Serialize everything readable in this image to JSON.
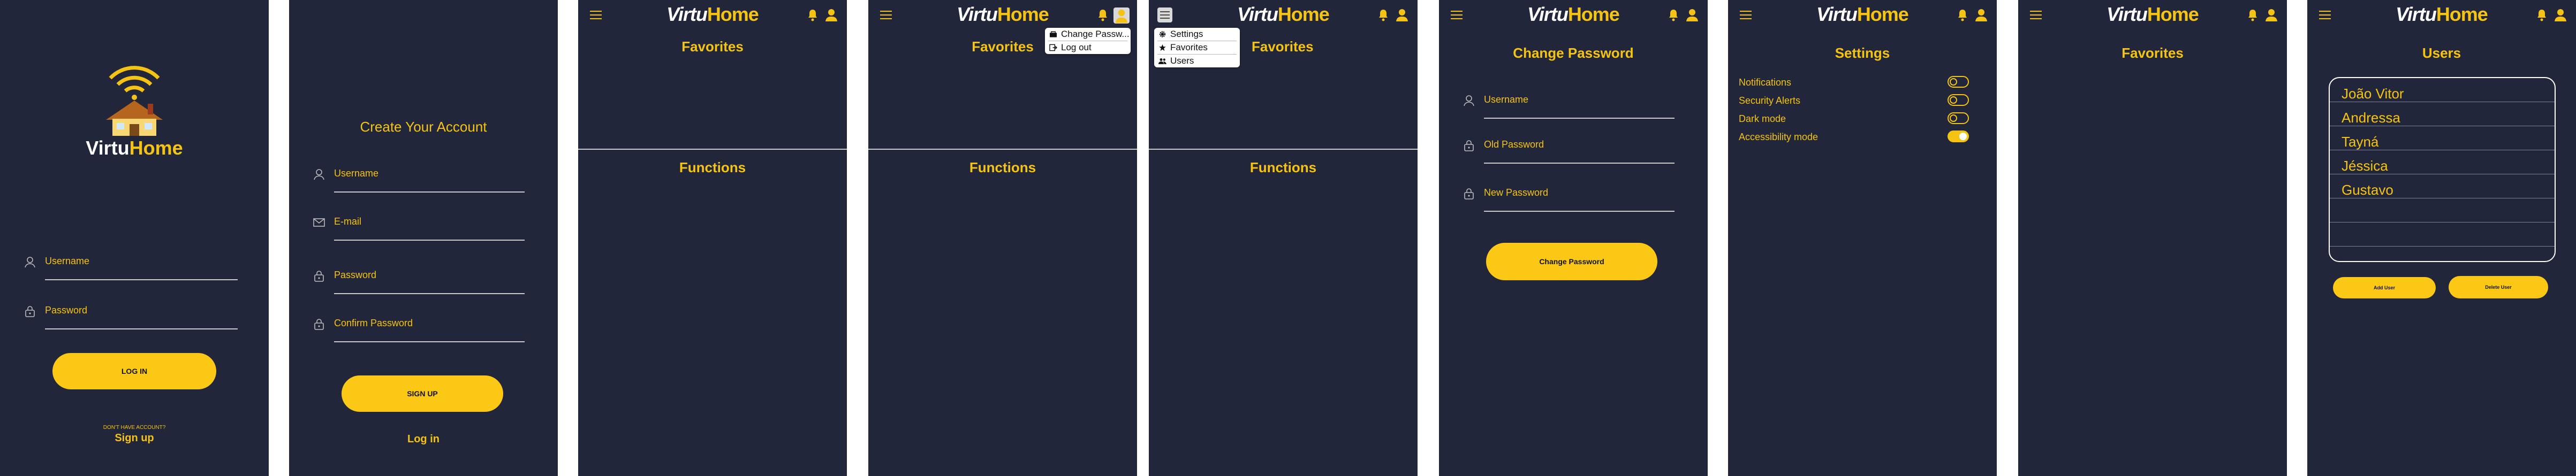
{
  "brand": {
    "part1": "Virtu",
    "part2": "Home"
  },
  "screen_login": {
    "logo_text_part1": "Virtu",
    "logo_text_part2": "Home",
    "username_label": "Username",
    "password_label": "Password",
    "login_button": "LOG IN",
    "no_account_text": "DON'T HAVE ACCOUNT?",
    "signup_link": "Sign up"
  },
  "screen_signup": {
    "title": "Create Your Account",
    "username_label": "Username",
    "email_label": "E-mail",
    "password_label": "Password",
    "confirm_label": "Confirm Password",
    "signup_button": "SIGN UP",
    "login_link": "Log in"
  },
  "screen_home": {
    "favorites_title": "Favorites",
    "functions_title": "Functions"
  },
  "screen_profile_menu": {
    "favorites_title": "Favorites",
    "functions_title": "Functions",
    "menu": [
      {
        "label": "Change Passw...",
        "icon": "key-icon"
      },
      {
        "label": "Log out",
        "icon": "logout-icon"
      }
    ]
  },
  "screen_hamburger_menu": {
    "favorites_title": "Favorites",
    "functions_title": "Functions",
    "menu": [
      {
        "label": "Settings",
        "icon": "gear-icon"
      },
      {
        "label": "Favorites",
        "icon": "star-icon"
      },
      {
        "label": "Users",
        "icon": "users-icon"
      }
    ]
  },
  "screen_change_password": {
    "title": "Change Password",
    "username_label": "Username",
    "old_password_label": "Old Password",
    "new_password_label": "New Password",
    "submit_button": "Change Password"
  },
  "screen_settings": {
    "title": "Settings",
    "options": [
      {
        "label": "Notifications",
        "on": false
      },
      {
        "label": "Security Alerts",
        "on": false
      },
      {
        "label": "Dark mode",
        "on": false
      },
      {
        "label": "Accessibility mode",
        "on": true
      }
    ]
  },
  "screen_favorites": {
    "title": "Favorites"
  },
  "screen_users": {
    "title": "Users",
    "users": [
      "João Vitor",
      "Andressa",
      "Tayná",
      "Jéssica",
      "Gustavo"
    ],
    "add_button": "Add User",
    "delete_button": "Delete User"
  },
  "colors": {
    "background": "#22263a",
    "accent": "#f5c314",
    "page": "#ffffff"
  }
}
